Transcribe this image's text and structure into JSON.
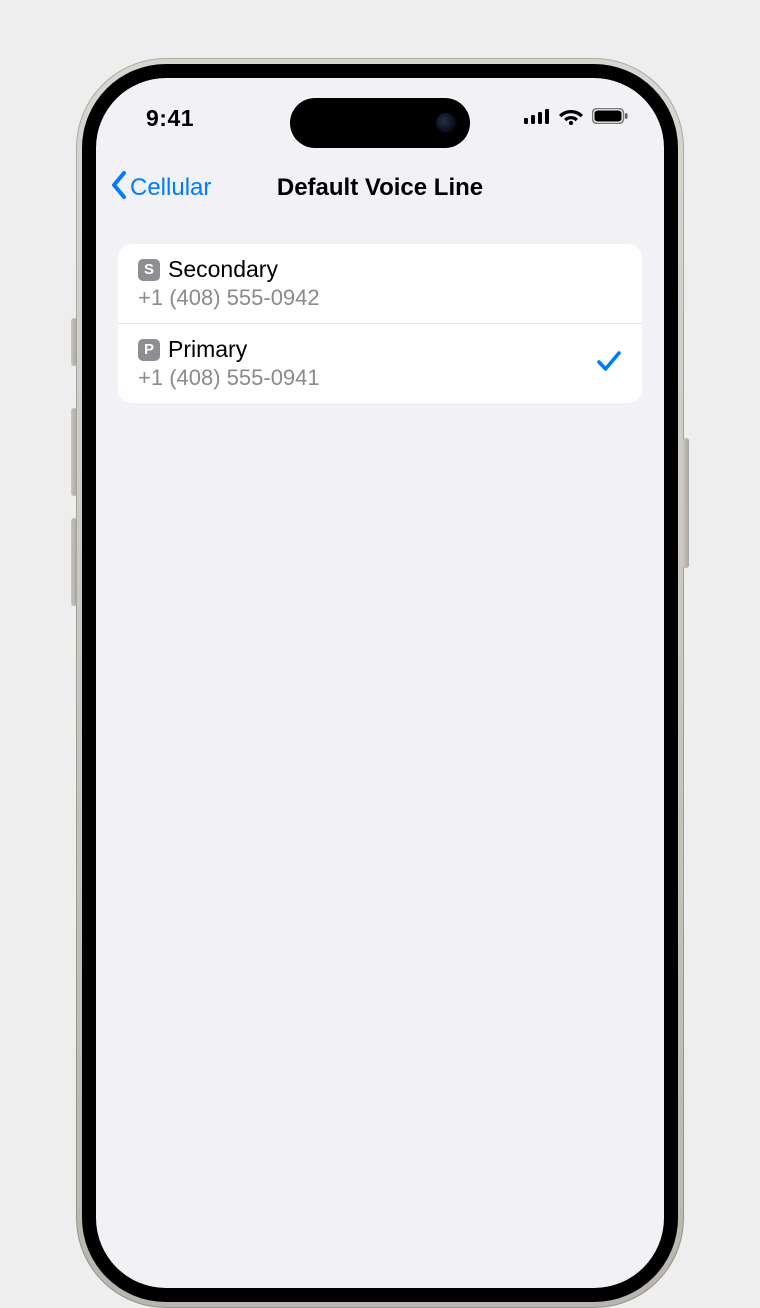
{
  "status": {
    "time": "9:41"
  },
  "nav": {
    "back_label": "Cellular",
    "title": "Default Voice Line"
  },
  "lines": [
    {
      "badge": "S",
      "name": "Secondary",
      "number": "+1 (408) 555-0942",
      "selected": false
    },
    {
      "badge": "P",
      "name": "Primary",
      "number": "+1 (408) 555-0941",
      "selected": true
    }
  ]
}
